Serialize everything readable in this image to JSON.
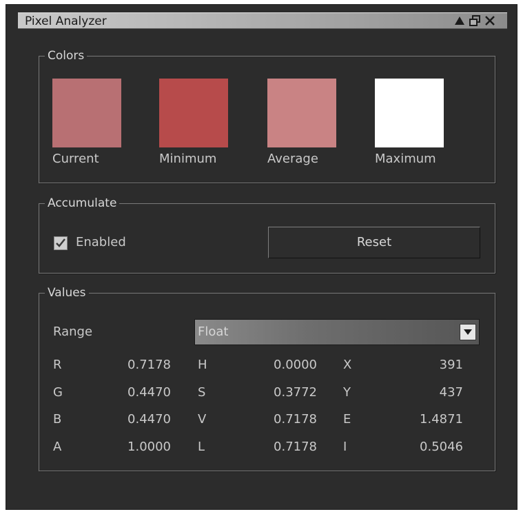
{
  "window": {
    "title": "Pixel Analyzer"
  },
  "colors_group": {
    "legend": "Colors",
    "swatches": [
      {
        "label": "Current",
        "color": "#b87073"
      },
      {
        "label": "Minimum",
        "color": "#b74b4b"
      },
      {
        "label": "Average",
        "color": "#c98384"
      },
      {
        "label": "Maximum",
        "color": "#ffffff"
      }
    ]
  },
  "accumulate_group": {
    "legend": "Accumulate",
    "enabled_label": "Enabled",
    "enabled_checked": true,
    "reset_label": "Reset"
  },
  "values_group": {
    "legend": "Values",
    "range_label": "Range",
    "range_value": "Float",
    "columns": [
      [
        {
          "label": "R",
          "value": "0.7178"
        },
        {
          "label": "G",
          "value": "0.4470"
        },
        {
          "label": "B",
          "value": "0.4470"
        },
        {
          "label": "A",
          "value": "1.0000"
        }
      ],
      [
        {
          "label": "H",
          "value": "0.0000"
        },
        {
          "label": "S",
          "value": "0.3772"
        },
        {
          "label": "V",
          "value": "0.7178"
        },
        {
          "label": "L",
          "value": "0.7178"
        }
      ],
      [
        {
          "label": "X",
          "value": "391"
        },
        {
          "label": "Y",
          "value": "437"
        },
        {
          "label": "E",
          "value": "1.4871"
        },
        {
          "label": "I",
          "value": "0.5046"
        }
      ]
    ]
  },
  "icons": {
    "titlebar": [
      "pin-triangle-icon",
      "restore-window-icon",
      "close-icon"
    ],
    "checkbox": "checkmark-icon",
    "dropdown": "dropdown-arrow-icon"
  }
}
